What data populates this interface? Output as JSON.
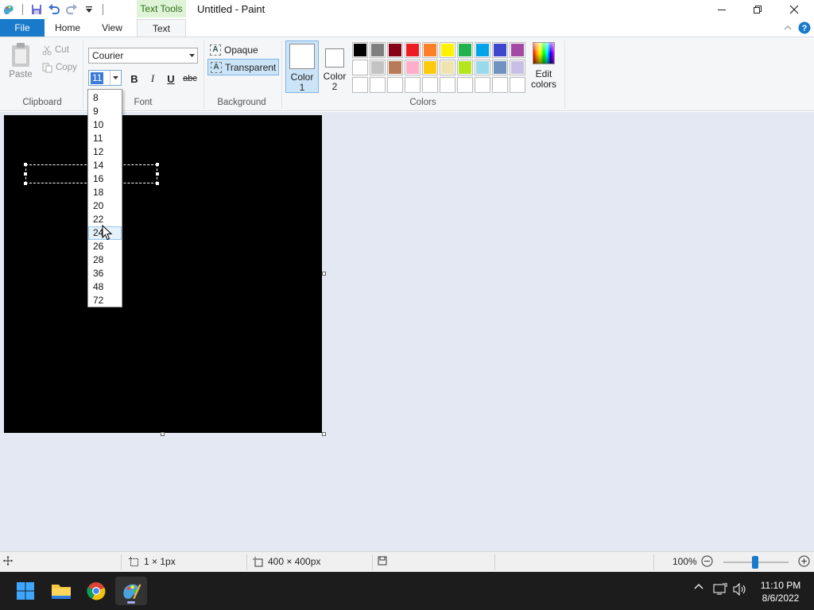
{
  "window": {
    "title": "Untitled - Paint",
    "context_tab": "Text Tools"
  },
  "tabs": {
    "file": "File",
    "home": "Home",
    "view": "View",
    "text": "Text"
  },
  "clipboard": {
    "paste": "Paste",
    "cut": "Cut",
    "copy": "Copy",
    "label": "Clipboard"
  },
  "font": {
    "family": "Courier",
    "size": "11",
    "bold": "B",
    "italic": "I",
    "underline": "U",
    "strikethrough": "abc",
    "label": "Font"
  },
  "background": {
    "opaque": "Opaque",
    "transparent": "Transparent",
    "selected": "Transparent",
    "label": "Background"
  },
  "colors": {
    "color1_label_line1": "Color",
    "color1_label_line2": "1",
    "color2_label_line1": "Color",
    "color2_label_line2": "2",
    "color1": "#ffffff",
    "color2": "#ffffff",
    "edit_line1": "Edit",
    "edit_line2": "colors",
    "label": "Colors",
    "palette": [
      "#000000",
      "#7f7f7f",
      "#880015",
      "#ed1c24",
      "#ff7f27",
      "#fff200",
      "#22b14c",
      "#00a2e8",
      "#3f48cc",
      "#a349a4",
      "#ffffff",
      "#c3c3c3",
      "#b97a57",
      "#ffaec9",
      "#ffc90e",
      "#efe4b0",
      "#b5e61d",
      "#99d9ea",
      "#7092be",
      "#c8bfe7",
      "#ffffff",
      "#ffffff",
      "#ffffff",
      "#ffffff",
      "#ffffff",
      "#ffffff",
      "#ffffff",
      "#ffffff",
      "#ffffff",
      "#ffffff"
    ]
  },
  "size_dropdown": {
    "options": [
      "8",
      "9",
      "10",
      "11",
      "12",
      "14",
      "16",
      "18",
      "20",
      "22",
      "24",
      "26",
      "28",
      "36",
      "48",
      "72"
    ],
    "hovered": "24"
  },
  "status": {
    "selection_size": "1 × 1px",
    "image_size": "400 × 400px",
    "zoom": "100%"
  },
  "clock": {
    "time": "11:10 PM",
    "date": "8/6/2022"
  }
}
